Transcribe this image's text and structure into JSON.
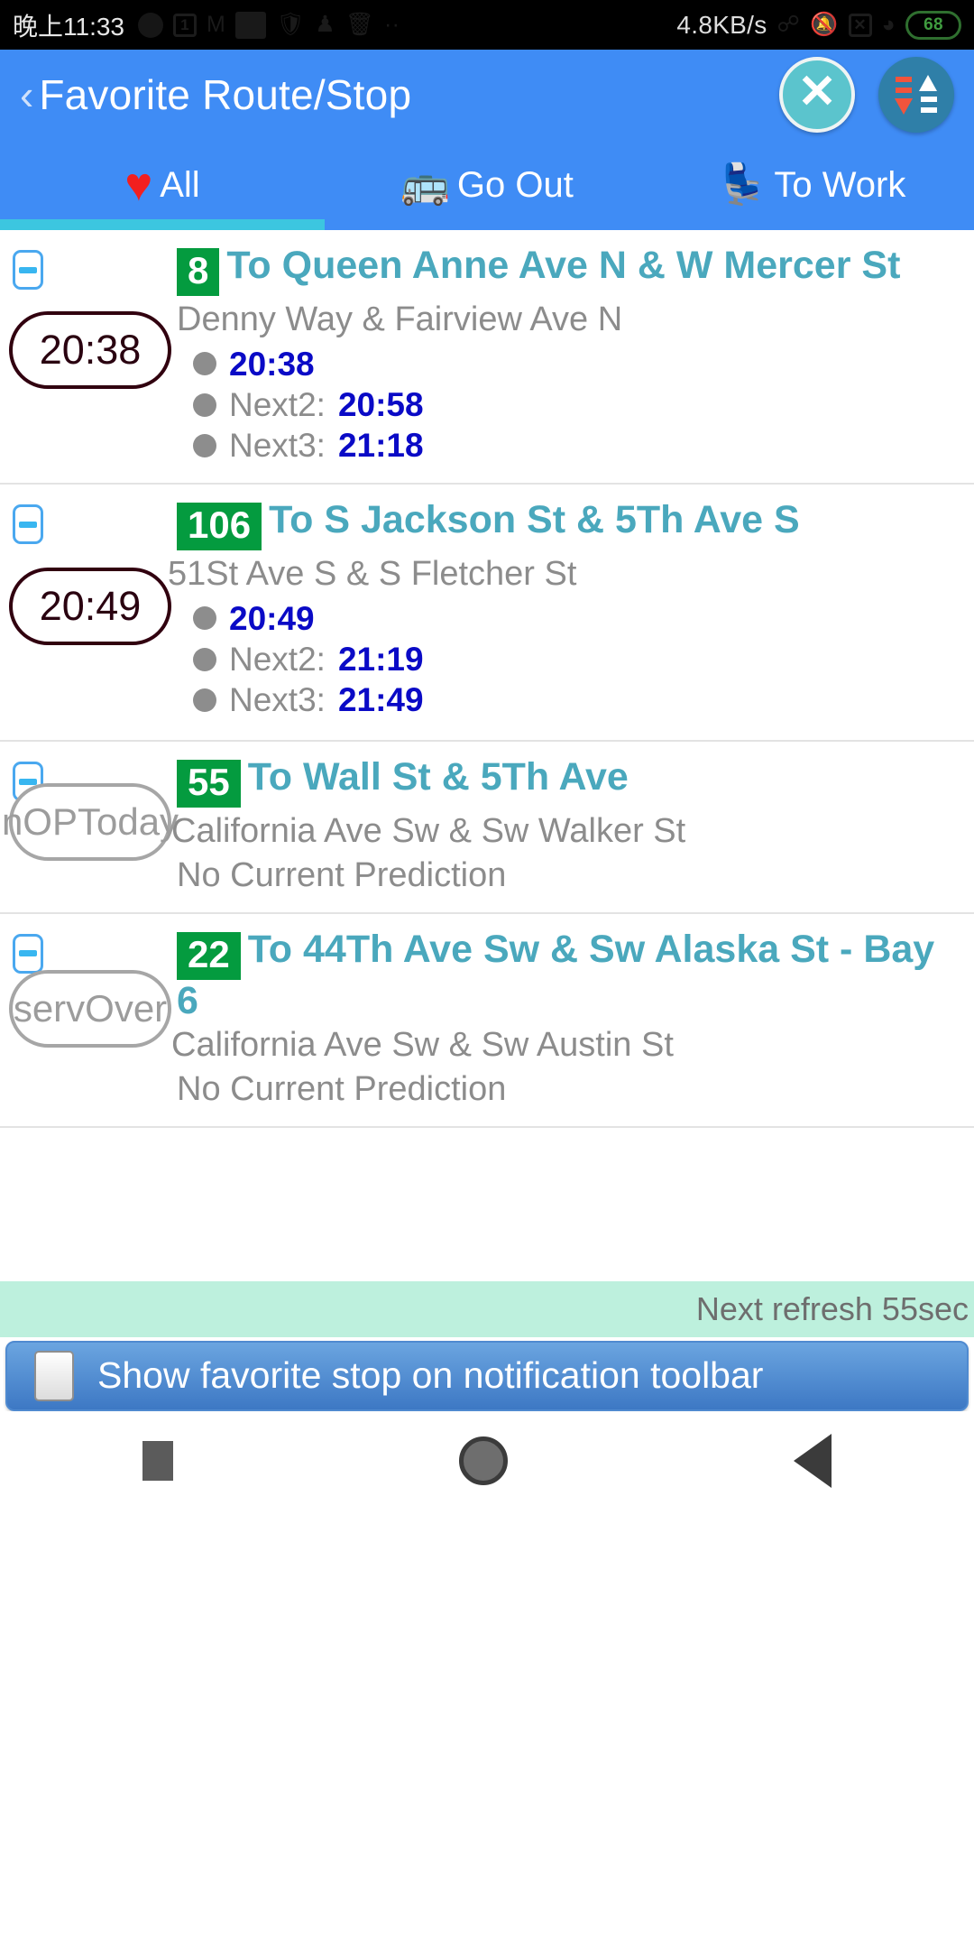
{
  "status_bar": {
    "clock": "晚上11:33",
    "network_speed": "4.8KB/s",
    "battery_percent": "68",
    "icons": [
      "moon-icon",
      "calendar-icon",
      "gmail-icon",
      "tag-icon",
      "shield-icon",
      "key-icon",
      "trash-icon",
      "more-icon",
      "bluetooth-icon",
      "silent-bell-icon",
      "sim-x-icon",
      "wifi-icon",
      "battery-icon"
    ]
  },
  "app_bar": {
    "back_label": "‹",
    "title": "Favorite Route/Stop",
    "close_label": "✕",
    "sort_icon": "sort-up-down-icon"
  },
  "tabs": [
    {
      "id": "all",
      "emoji": "♥",
      "label": "All",
      "active": true
    },
    {
      "id": "go-out",
      "emoji": "🚌",
      "label": "Go Out",
      "active": false
    },
    {
      "id": "to-work",
      "emoji": "💺",
      "label": "To Work",
      "active": false
    }
  ],
  "items": [
    {
      "collapse_icon": "minus-icon",
      "pill": "20:38",
      "pill_muted": false,
      "route": "8",
      "destination": "To Queen Anne Ave N & W Mercer St",
      "stop": "Denny Way & Fairview Ave N",
      "predictions": [
        {
          "label": "",
          "time": "20:38"
        },
        {
          "label": "Next2:",
          "time": "20:58"
        },
        {
          "label": "Next3:",
          "time": "21:18"
        }
      ],
      "no_prediction": ""
    },
    {
      "collapse_icon": "minus-icon",
      "pill": "20:49",
      "pill_muted": false,
      "route": "106",
      "destination": "To S Jackson St & 5Th Ave S",
      "stop": "51St Ave S & S Fletcher St",
      "predictions": [
        {
          "label": "",
          "time": "20:49"
        },
        {
          "label": "Next2:",
          "time": "21:19"
        },
        {
          "label": "Next3:",
          "time": "21:49"
        }
      ],
      "no_prediction": ""
    },
    {
      "collapse_icon": "minus-icon",
      "pill": "nOPToday",
      "pill_muted": true,
      "route": "55",
      "destination": "To Wall St & 5Th Ave",
      "stop": "California Ave Sw & Sw Walker St",
      "predictions": [],
      "no_prediction": "No Current Prediction"
    },
    {
      "collapse_icon": "minus-icon",
      "pill": "servOver",
      "pill_muted": true,
      "route": "22",
      "destination": "To 44Th Ave Sw & Sw Alaska St - Bay 6",
      "stop": "California Ave Sw & Sw Austin St",
      "predictions": [],
      "no_prediction": "No Current Prediction"
    }
  ],
  "footer": {
    "refresh_text": "Next refresh 55sec",
    "notification_label": "Show favorite stop on notification toolbar",
    "checkbox_checked": false
  },
  "nav_bar": {
    "recent": "recents-square-icon",
    "home": "home-circle-icon",
    "back": "back-triangle-icon"
  },
  "colors": {
    "app_bar": "#3f8cf5",
    "tab_underline": "#3cc6e0",
    "route_badge": "#049b3f",
    "headline": "#4aa8bd",
    "prediction_time": "#0a0ac6",
    "pill_border": "#31000f",
    "pill_border_muted": "#a6a6a6",
    "refresh_bar": "#bdf0dd"
  }
}
